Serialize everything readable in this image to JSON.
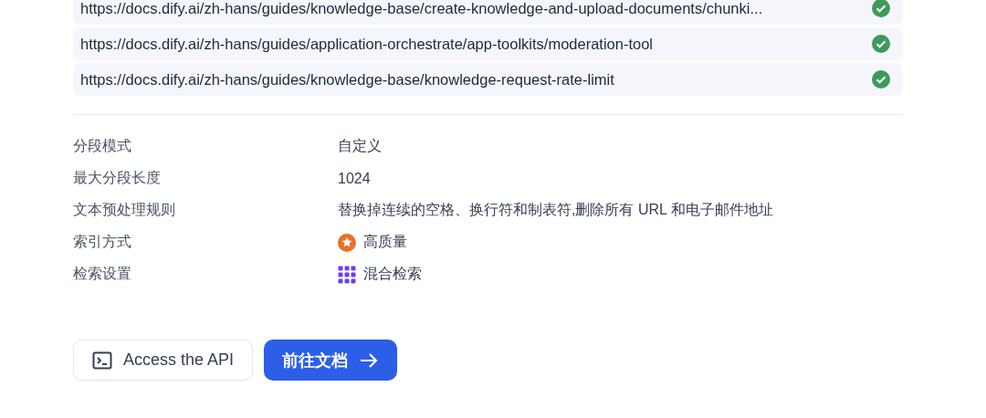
{
  "urls": [
    {
      "url": "https://docs.dify.ai/zh-hans/guides/knowledge-base/create-knowledge-and-upload-documents/chunki...",
      "done": true
    },
    {
      "url": "https://docs.dify.ai/zh-hans/guides/application-orchestrate/app-toolkits/moderation-tool",
      "done": true
    },
    {
      "url": "https://docs.dify.ai/zh-hans/guides/knowledge-base/knowledge-request-rate-limit",
      "done": true
    }
  ],
  "settings": [
    {
      "label": "分段模式",
      "value": "自定义",
      "kind": "text"
    },
    {
      "label": "最大分段长度",
      "value": "1024",
      "kind": "text"
    },
    {
      "label": "文本预处理规则",
      "value": "替换掉连续的空格、换行符和制表符,删除所有 URL 和电子邮件地址",
      "kind": "text"
    },
    {
      "label": "索引方式",
      "value": "高质量",
      "kind": "quality"
    },
    {
      "label": "检索设置",
      "value": "混合检索",
      "kind": "hybrid"
    }
  ],
  "buttons": [
    {
      "label": "Access the API",
      "kind": "api"
    },
    {
      "label": "前往文档",
      "kind": "docs"
    }
  ]
}
